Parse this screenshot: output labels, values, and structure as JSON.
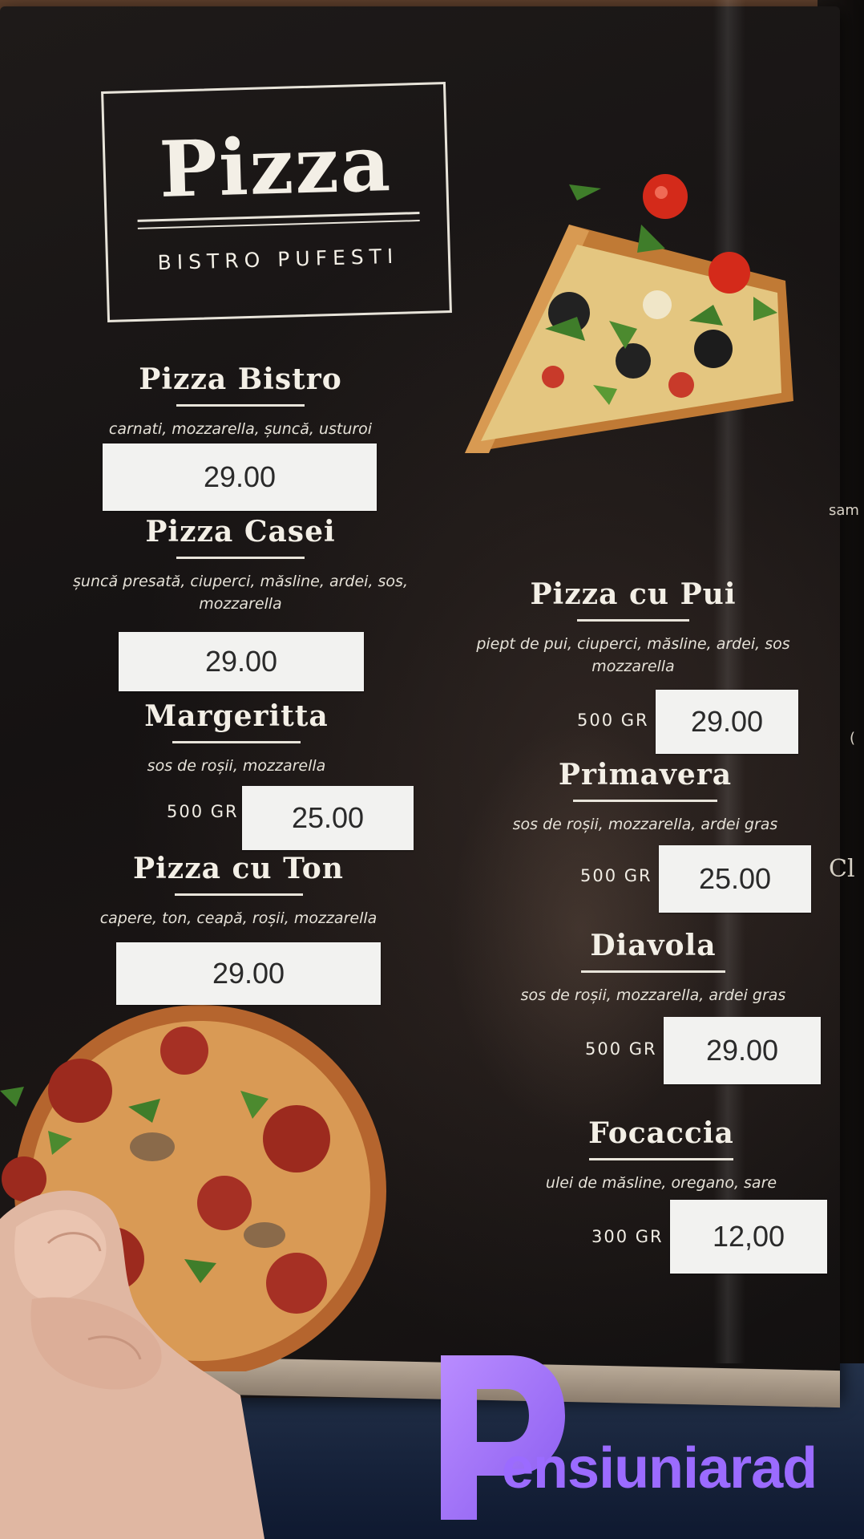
{
  "menu": {
    "title": "Pizza",
    "subtitle": "BISTRO PUFESTI",
    "items": [
      {
        "name": "Pizza Bistro",
        "description": "carnati, mozzarella, șuncă, usturoi",
        "weight": "",
        "price": "29.00"
      },
      {
        "name": "Pizza Casei",
        "description": "șuncă presată, ciuperci, măsline, ardei, sos, mozzarella",
        "weight": "",
        "price": "29.00"
      },
      {
        "name": "Margeritta",
        "description": "sos de roșii, mozzarella",
        "weight": "500 GR",
        "price": "25.00"
      },
      {
        "name": "Pizza cu Ton",
        "description": "capere, ton, ceapă, roșii, mozzarella",
        "weight": "",
        "price": "29.00"
      },
      {
        "name": "Pizza cu Pui",
        "description": "piept de pui, ciuperci, măsline, ardei, sos mozzarella",
        "weight": "500 GR",
        "price": "29.00"
      },
      {
        "name": "Primavera",
        "description": "sos de roșii, mozzarella, ardei gras",
        "weight": "500 GR",
        "price": "25.00"
      },
      {
        "name": "Diavola",
        "description": "sos de roșii, mozzarella, ardei gras",
        "weight": "500 GR",
        "price": "29.00"
      },
      {
        "name": "Focaccia",
        "description": "ulei de măsline, oregano, sare",
        "weight": "300 GR",
        "price": "12,00"
      }
    ],
    "edge_fragments": [
      "sam",
      "Cl",
      "("
    ]
  },
  "watermark": {
    "text": "ensiuniarad",
    "color": "#9b6bff"
  },
  "images": {
    "pizza_slice": "pizza-slice-photo",
    "pizza_whole": "whole-pizza-photo",
    "hand": "hand-holding-menu"
  }
}
